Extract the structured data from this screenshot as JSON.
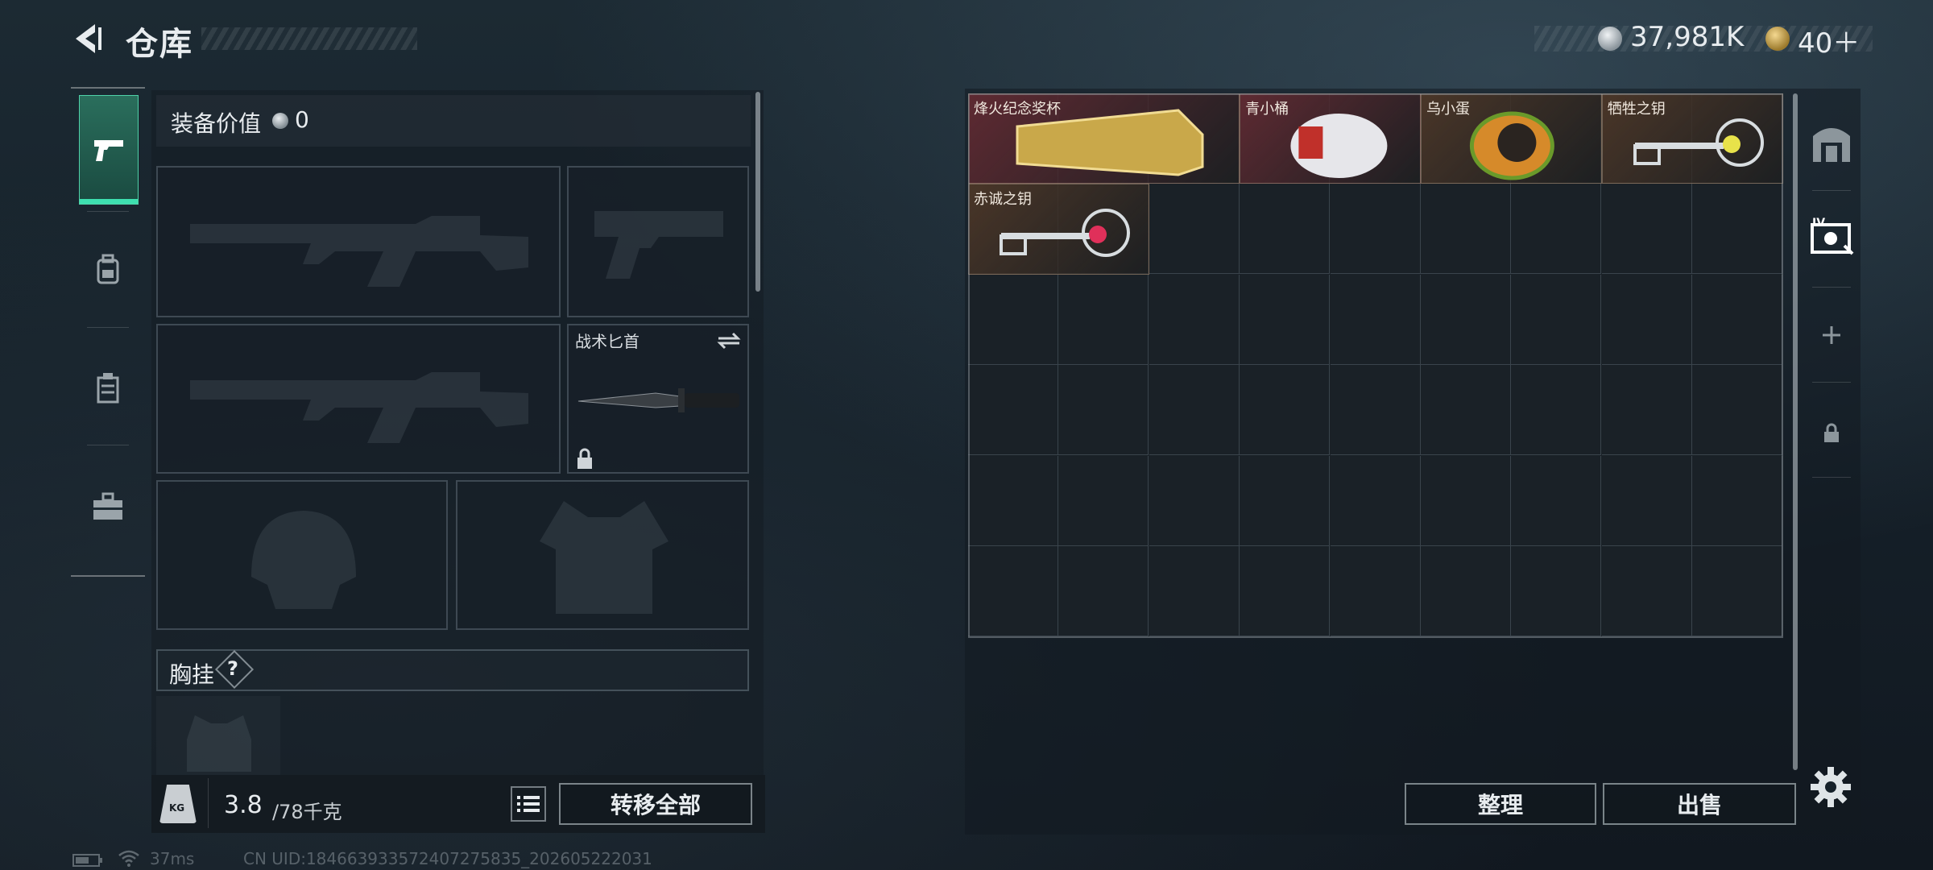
{
  "header": {
    "title": "仓库",
    "currency_silver": "37,981K",
    "currency_gold": "40＋"
  },
  "left_rail": {
    "tabs": [
      {
        "name": "weapons",
        "icon": "pistol-icon",
        "active": true
      },
      {
        "name": "backpack",
        "icon": "backpack-icon",
        "active": false
      },
      {
        "name": "vest",
        "icon": "vest-icon",
        "active": false
      },
      {
        "name": "toolbox",
        "icon": "toolbox-icon",
        "active": false
      }
    ]
  },
  "loadout": {
    "value_label": "装备价值",
    "value": "0",
    "knife_label": "战术匕首",
    "chest_rig_label": "胸挂",
    "help_symbol": "?",
    "weight_icon_text": "KG",
    "weight_current": "3.8",
    "weight_max": "/78千克",
    "transfer_all": "转移全部"
  },
  "storage": {
    "columns": 9,
    "rows": 6,
    "items": [
      {
        "name": "烽火纪念奖杯",
        "col": 0,
        "row": 0,
        "w": 3,
        "h": 1,
        "bg": "#5e2a32"
      },
      {
        "name": "青小桶",
        "col": 3,
        "row": 0,
        "w": 2,
        "h": 1,
        "bg": "#5e2a32"
      },
      {
        "name": "乌小蛋",
        "col": 5,
        "row": 0,
        "w": 2,
        "h": 1,
        "bg": "#4a3628"
      },
      {
        "name": "牺牲之钥",
        "col": 7,
        "row": 0,
        "w": 2,
        "h": 1,
        "bg": "#4a3628"
      },
      {
        "name": "赤诚之钥",
        "col": 0,
        "row": 1,
        "w": 2,
        "h": 1,
        "bg": "#4a3628"
      }
    ],
    "sort_button": "整理",
    "sell_button": "出售"
  },
  "right_rail": {
    "buttons": [
      "safe-box-icon",
      "collection-icon",
      "add-icon",
      "lock-icon"
    ]
  },
  "footer": {
    "ping": "37ms",
    "uid": "CN UID:184663933572407275835_202605222031"
  },
  "colors": {
    "accent": "#3ee0b0",
    "trophy_bg": "#5e2a32",
    "item_bg": "#4a3628"
  }
}
